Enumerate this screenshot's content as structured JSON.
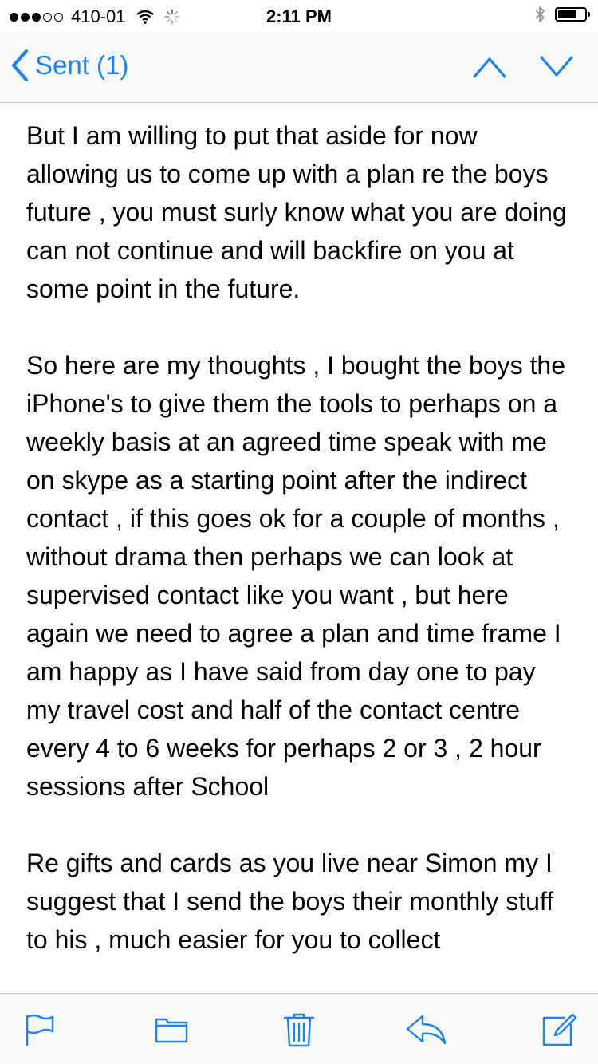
{
  "status_bar": {
    "carrier": "410-01",
    "time": "2:11 PM",
    "signal_strength": 3,
    "signal_total": 5,
    "battery_level": 0.72,
    "icons": [
      "wifi-icon",
      "activity-spinner-icon",
      "bluetooth-icon",
      "battery-icon"
    ]
  },
  "nav": {
    "back_label": "Sent (1)",
    "accent_color": "#1a82fb",
    "icons": [
      "back-chevron-icon",
      "chevron-up-icon",
      "chevron-down-icon"
    ]
  },
  "message": {
    "paragraphs": [
      "But I am willing to put that aside for now allowing us to come up with a plan re the boys future , you must surly know what you are doing can not continue and will backfire on you at some point in the future.",
      "So here are my thoughts , I bought the boys the iPhone's to give them the tools to perhaps on a weekly basis at an agreed time speak with me on skype as a starting point after the indirect contact , if this goes ok for a couple of months , without drama then perhaps we can look at supervised contact like you want , but here again we need to agree a plan and time frame I am happy as I have said from day one to pay my travel cost and half of the contact centre every 4 to 6 weeks for perhaps 2 or 3 , 2 hour sessions after School",
      "Re gifts and cards as you live near Simon my I suggest that I send the boys their monthly stuff to his , much easier for you to collect"
    ]
  },
  "toolbar": {
    "icons": [
      "flag-icon",
      "folder-icon",
      "trash-icon",
      "reply-icon",
      "compose-icon"
    ]
  }
}
